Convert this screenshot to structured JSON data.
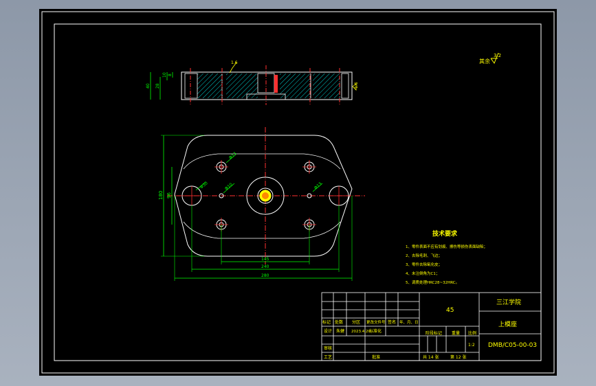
{
  "drawing": {
    "roughness_note": "其余",
    "roughness_value": "3.2",
    "side_view": {
      "ra_left": "1.6",
      "ra_right": "1.6",
      "dim_height_total": "40",
      "dim_height_a": "28",
      "dim_height_b": "10",
      "dim_height_c": "8"
    },
    "plan_view": {
      "dim_width_inner": "145",
      "dim_width_mid": "240",
      "dim_width_overall": "280",
      "dim_height_overall": "180",
      "dim_height_inner": "96",
      "dim_hole_ul": "Φ13",
      "dim_hole_left": "Φ30",
      "dim_hole_center": "Φ10",
      "dim_hole_right": "Φ13"
    },
    "tech_req": {
      "title": "技术要求",
      "items": [
        "1、零件表面不应有划痕、擦伤等损伤表面缺陷；",
        "2、去除毛刺、飞边；",
        "3、零件去除氧化皮；",
        "4、未注倒角为C1；",
        "5、调质处理HRC28~32HRC。"
      ]
    }
  },
  "title_block": {
    "material": "45",
    "company": "三江学院",
    "part_name": "上模座",
    "drawing_no": "DMB/C05-00-03",
    "scale": "1:2",
    "sheets_total": "共 14 张",
    "sheet_no": "第 12 张",
    "labels": {
      "mark": "标记",
      "count": "处数",
      "zone": "分区",
      "change_doc": "更改文件号",
      "sign": "签名",
      "date": "年、月、日",
      "design": "设计",
      "designer": "朱健",
      "design_date": "2023.4.20",
      "standardize": "标准化",
      "stage_mark": "阶段标记",
      "weight": "重量",
      "scale_label": "比例",
      "review": "审核",
      "process": "工艺",
      "approve": "批准"
    }
  }
}
